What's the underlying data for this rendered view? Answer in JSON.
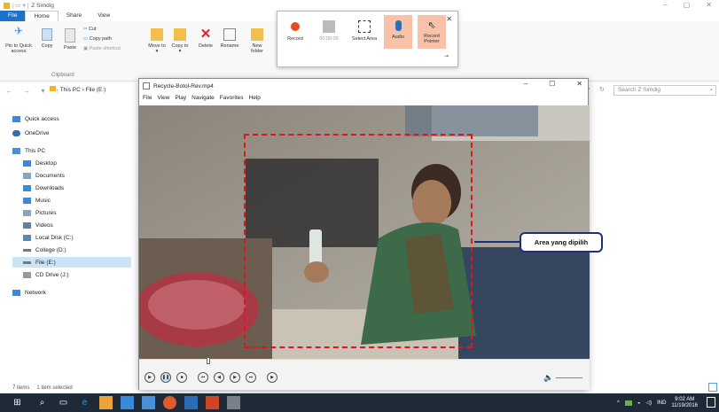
{
  "explorer": {
    "title": "Z Simdig",
    "tabs": [
      "File",
      "Home",
      "Share",
      "View"
    ],
    "ribbon": {
      "pin_label": "Pin to Quick access",
      "copy_label": "Copy",
      "paste_label": "Paste",
      "cut_label": "Cut",
      "copy_path_label": "Copy path",
      "paste_shortcut_label": "Paste shortcut",
      "clipboard_label": "Clipboard",
      "move_label": "Move to ▾",
      "copy_to_label": "Copy to ▾",
      "delete_label": "Delete",
      "rename_label": "Rename",
      "new_folder_label": "New folder"
    },
    "breadcrumb": "This PC › File (E:)",
    "search_placeholder": "Search Z Simdig",
    "sidebar": [
      {
        "label": "Quick access",
        "color": "#3b8ad9"
      },
      {
        "label": "OneDrive",
        "color": "#2f6db5"
      },
      {
        "label": "This PC",
        "color": "#4a90d9"
      },
      {
        "label": "Desktop",
        "color": "#3f87d6"
      },
      {
        "label": "Documents",
        "color": "#8aa4c0"
      },
      {
        "label": "Downloads",
        "color": "#3b8ad9"
      },
      {
        "label": "Music",
        "color": "#3b8ad9"
      },
      {
        "label": "Pictures",
        "color": "#8aa4c0"
      },
      {
        "label": "Videos",
        "color": "#6a7f9a"
      },
      {
        "label": "Local Disk (C:)",
        "color": "#5f86b0"
      },
      {
        "label": "College (D:)",
        "color": "#777777"
      },
      {
        "label": "File (E:)",
        "color": "#777777"
      },
      {
        "label": "CD Drive (J:)",
        "color": "#999999"
      },
      {
        "label": "Network",
        "color": "#3b8ad9"
      }
    ],
    "status": {
      "items": "7 items",
      "selected": "1 item selected"
    }
  },
  "recorder": {
    "record_label": "Record",
    "time_label": "00:00:00",
    "select_area_label": "Select Area",
    "audio_label": "Audio",
    "record_pointer_label": "Record Pointer"
  },
  "player": {
    "title": "Recycle-Botol-Rev.mp4",
    "menu": [
      "File",
      "View",
      "Play",
      "Navigate",
      "Favorites",
      "Help"
    ],
    "seek_progress": 0.15
  },
  "annotation": {
    "callout_label": "Area yang dipilih",
    "frame_color": "#e0161c",
    "callout_border": "#1d2f7a"
  },
  "taskbar": {
    "lang": "IND",
    "time": "9:02 AM",
    "date": "11/19/2016"
  }
}
